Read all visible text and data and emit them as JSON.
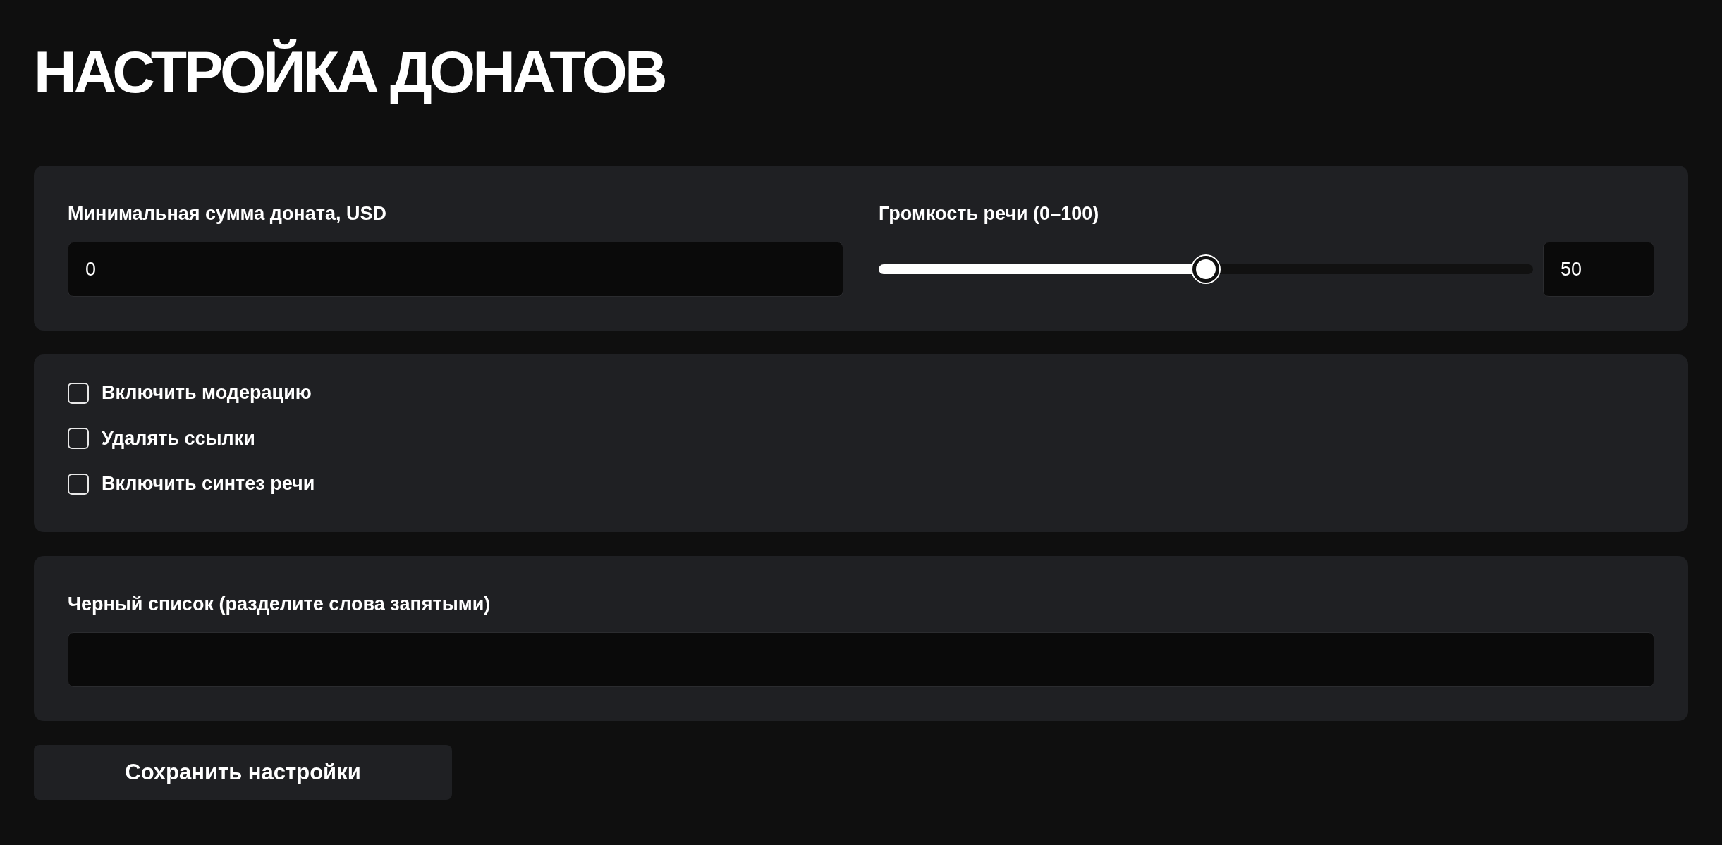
{
  "title": "НАСТРОЙКА ДОНАТОВ",
  "min_donation": {
    "label": "Минимальная сумма доната, USD",
    "value": "0"
  },
  "volume": {
    "label": "Громкость речи (0–100)",
    "level": 0.5,
    "value": "50"
  },
  "options": [
    {
      "label": "Включить модерацию",
      "checked": false
    },
    {
      "label": "Удалять ссылки",
      "checked": false
    },
    {
      "label": "Включить синтез речи",
      "checked": false
    }
  ],
  "blacklist": {
    "label": "Черный список (разделите слова запятыми)"
  },
  "save_button": "Сохранить настройки"
}
